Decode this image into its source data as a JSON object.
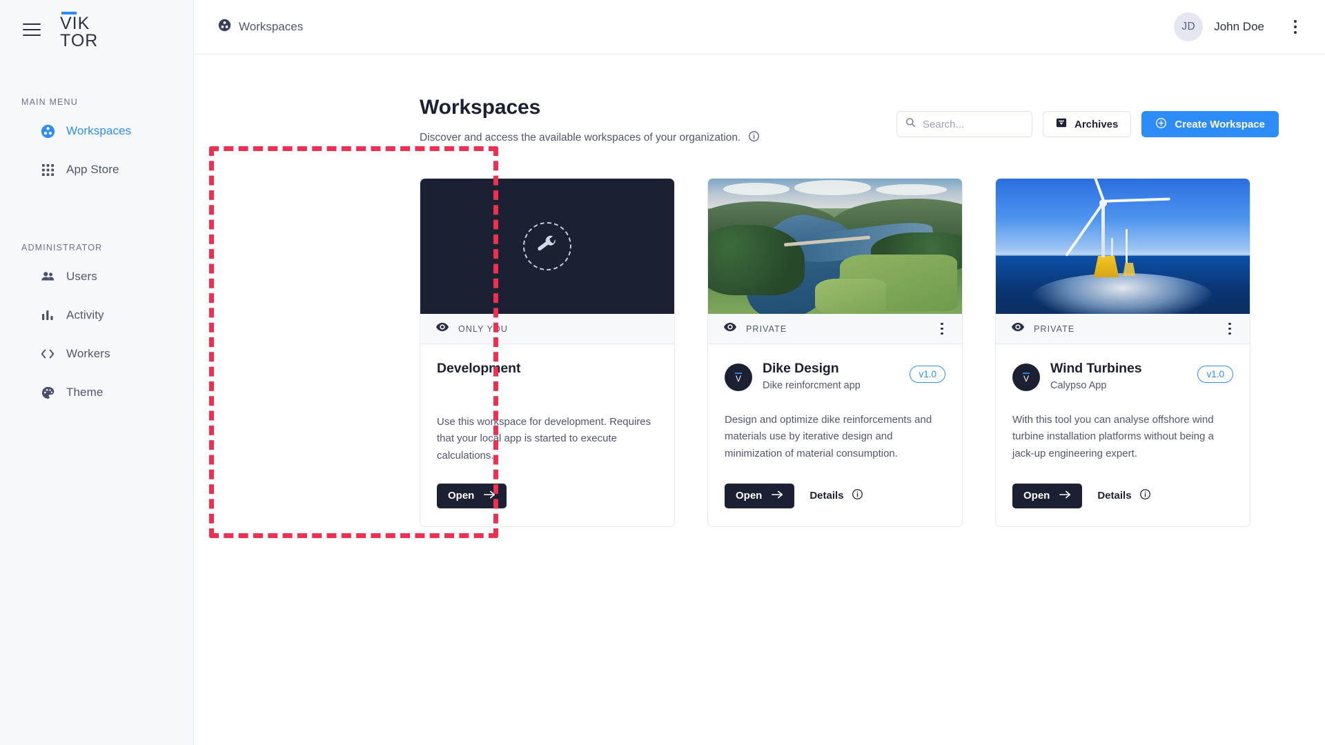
{
  "sidebar": {
    "logo": {
      "line1": "VIK",
      "line2": "TOR"
    },
    "sections": [
      {
        "label": "MAIN MENU",
        "items": [
          {
            "label": "Workspaces",
            "icon": "workspaces-icon",
            "active": true
          },
          {
            "label": "App Store",
            "icon": "grid-apps-icon",
            "active": false
          }
        ]
      },
      {
        "label": "ADMINISTRATOR",
        "items": [
          {
            "label": "Users",
            "icon": "users-icon",
            "active": false
          },
          {
            "label": "Activity",
            "icon": "bar-chart-icon",
            "active": false
          },
          {
            "label": "Workers",
            "icon": "code-brackets-icon",
            "active": false
          },
          {
            "label": "Theme",
            "icon": "palette-icon",
            "active": false
          }
        ]
      }
    ]
  },
  "topbar": {
    "breadcrumb": "Workspaces",
    "user": {
      "initials": "JD",
      "name": "John Doe"
    }
  },
  "page": {
    "title": "Workspaces",
    "subtitle": "Discover and access the available workspaces of your organization."
  },
  "toolbar": {
    "search_placeholder": "Search...",
    "search_value": "",
    "archives_label": "Archives",
    "create_label": "Create Workspace"
  },
  "colors": {
    "accent_blue": "#2d8cf7",
    "dark": "#1c2033",
    "sidebar_bg": "#f7f8fc",
    "highlight_red": "#ed2f52",
    "text_muted": "#51566f"
  },
  "cards": [
    {
      "id": "development",
      "banner_type": "placeholder-wrench",
      "visibility": "ONLY YOU",
      "has_menu": false,
      "has_avatar": false,
      "title": "Development",
      "subtitle": "",
      "version": "",
      "description": "Use this workspace for development. Requires that your local app is started to execute calculations.",
      "open_label": "Open",
      "details_label": "",
      "highlighted": true
    },
    {
      "id": "dike-design",
      "banner_type": "photo-dike",
      "visibility": "PRIVATE",
      "has_menu": true,
      "has_avatar": true,
      "title": "Dike Design",
      "subtitle": "Dike reinforcment app",
      "version": "v1.0",
      "description": "Design and optimize dike reinforcements and materials use by iterative design and minimization of material consumption.",
      "open_label": "Open",
      "details_label": "Details",
      "highlighted": false
    },
    {
      "id": "wind-turbines",
      "banner_type": "photo-wind",
      "visibility": "PRIVATE",
      "has_menu": true,
      "has_avatar": true,
      "title": "Wind Turbines",
      "subtitle": "Calypso App",
      "version": "v1.0",
      "description": "With this tool you can analyse offshore wind turbine installation platforms without being a jack-up engineering expert.",
      "open_label": "Open",
      "details_label": "Details",
      "highlighted": false
    }
  ]
}
